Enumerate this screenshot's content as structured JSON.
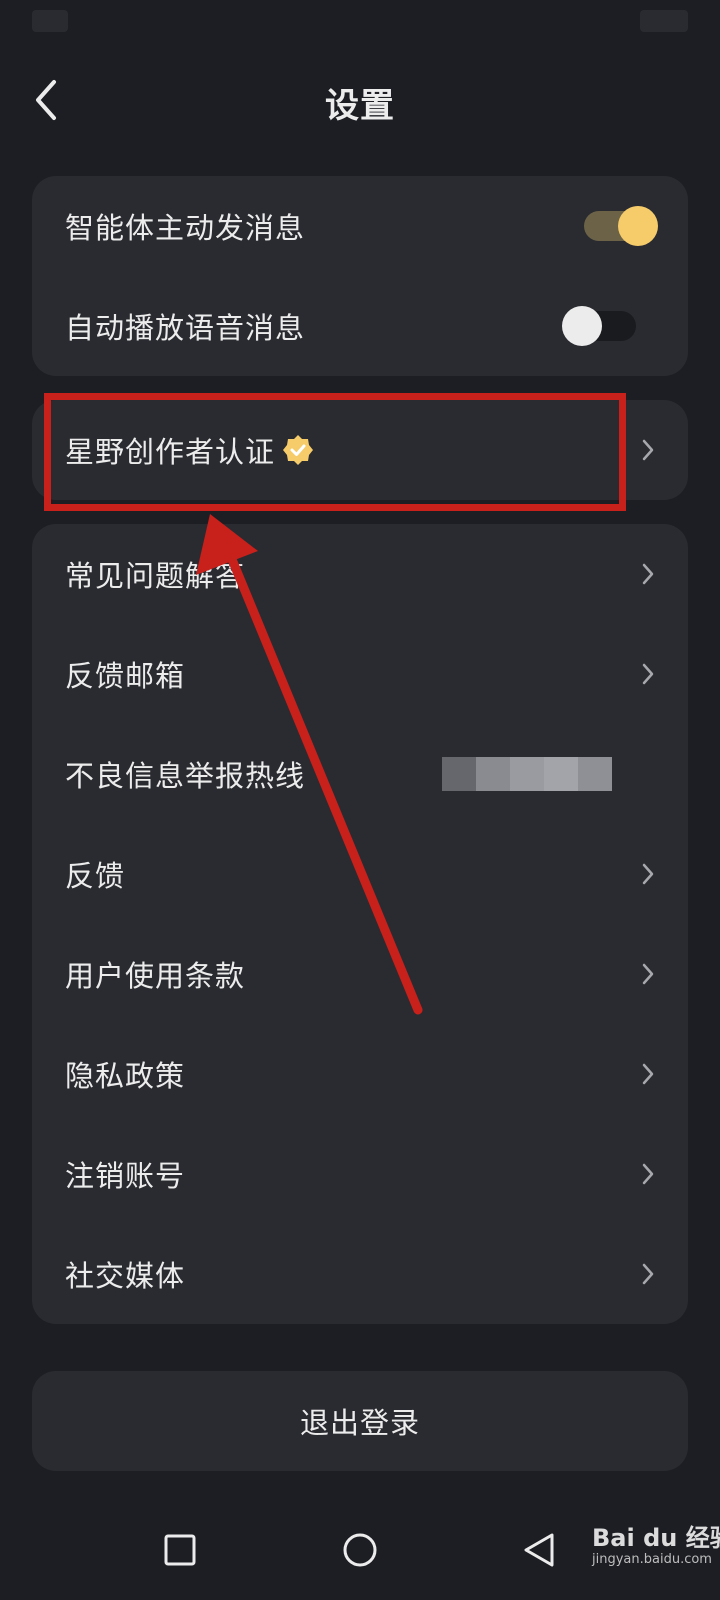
{
  "header": {
    "title": "设置"
  },
  "toggles": [
    {
      "label": "智能体主动发消息",
      "state": "on"
    },
    {
      "label": "自动播放语音消息",
      "state": "off"
    }
  ],
  "creator": {
    "label": "星野创作者认证"
  },
  "menu": [
    {
      "label": "常见问题解答"
    },
    {
      "label": "反馈邮箱"
    },
    {
      "label": "不良信息举报热线"
    },
    {
      "label": "反馈"
    },
    {
      "label": "用户使用条款"
    },
    {
      "label": "隐私政策"
    },
    {
      "label": "注销账号"
    },
    {
      "label": "社交媒体"
    }
  ],
  "logout": {
    "label": "退出登录"
  },
  "watermark": {
    "brand": "Bai du 经验",
    "url": "jingyan.baidu.com"
  },
  "colors": {
    "background": "#1d1e23",
    "card": "#2a2b30",
    "accent": "#f6cb6a",
    "annotation": "#c8201b"
  },
  "icons": {
    "back": "chevron-left-icon",
    "row": "chevron-right-icon",
    "badge": "verified-badge-icon"
  }
}
